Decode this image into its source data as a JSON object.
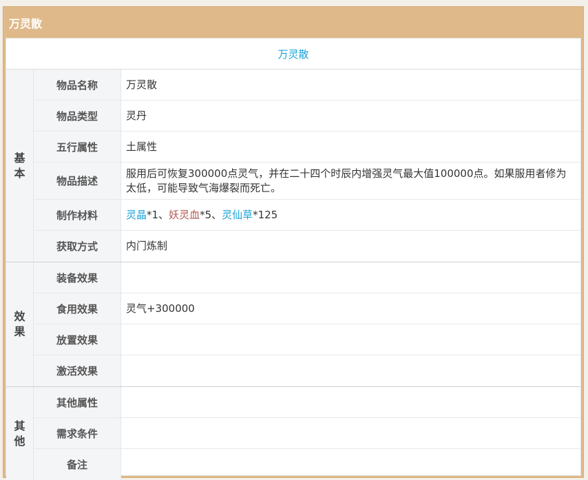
{
  "window": {
    "title": "万灵散"
  },
  "item": {
    "name_header": "万灵散"
  },
  "groups": [
    {
      "label": "基本",
      "rows": [
        {
          "label": "物品名称",
          "value": "万灵散"
        },
        {
          "label": "物品类型",
          "value": "灵丹"
        },
        {
          "label": "五行属性",
          "value": "土属性"
        },
        {
          "label": "物品描述",
          "value": "服用后可恢复300000点灵气，并在二十四个时辰内增强灵气最大值100000点。如果服用者修为太低，可能导致气海爆裂而死亡。"
        },
        {
          "label": "制作材料",
          "materials": [
            {
              "name": "灵晶",
              "qty": "*1",
              "sep": "、",
              "color": "#1aa3d8"
            },
            {
              "name": "妖灵血",
              "qty": "*5",
              "sep": "、",
              "color": "#b05a52"
            },
            {
              "name": "灵仙草",
              "qty": "*125",
              "sep": "",
              "color": "#1aa3d8"
            }
          ]
        },
        {
          "label": "获取方式",
          "value": "内门炼制"
        }
      ]
    },
    {
      "label": "效果",
      "rows": [
        {
          "label": "装备效果",
          "value": ""
        },
        {
          "label": "食用效果",
          "value": "灵气+300000"
        },
        {
          "label": "放置效果",
          "value": ""
        },
        {
          "label": "激活效果",
          "value": ""
        }
      ]
    },
    {
      "label": "其他",
      "rows": [
        {
          "label": "其他属性",
          "value": ""
        },
        {
          "label": "需求条件",
          "value": ""
        },
        {
          "label": "备注",
          "value": ""
        }
      ]
    }
  ],
  "colors": {
    "frame": "#dfb989",
    "link_blue": "#1aa3d8",
    "link_red": "#b05a52",
    "label_bg": "#f4f5f7"
  }
}
